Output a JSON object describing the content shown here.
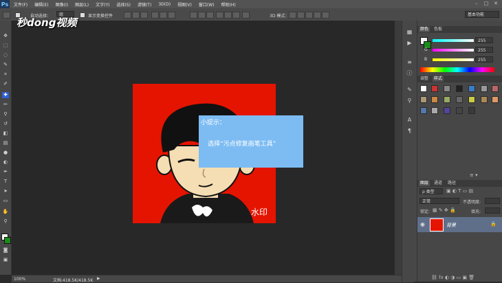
{
  "menubar": {
    "logo": "Ps",
    "items": [
      "文件(F)",
      "编辑(E)",
      "图像(I)",
      "图层(L)",
      "文字(Y)",
      "选择(S)",
      "滤镜(T)",
      "3D(D)",
      "视图(V)",
      "窗口(W)",
      "帮助(H)"
    ]
  },
  "optbar": {
    "auto_select": "自动选择：",
    "auto_select_value": "组",
    "show_transform": "显示变换控件",
    "mode_3d": "3D 模式：",
    "workspace": "基本功能"
  },
  "watermark_logo": "秒dong视频",
  "canvas": {
    "watermark": "水印"
  },
  "tip": {
    "title": "小提示：",
    "body": "选择“污点修复画笔工具”"
  },
  "statusbar": {
    "zoom": "100%",
    "doc": "文档:418.5K/418.5K"
  },
  "color_panel": {
    "tabs": [
      "颜色",
      "色板"
    ],
    "r_label": "R",
    "r_value": "255",
    "g_label": "G",
    "g_value": "255",
    "b_label": "B",
    "b_value": "255"
  },
  "styles_panel": {
    "tabs": [
      "调整",
      "样式"
    ]
  },
  "layers_panel": {
    "tabs": [
      "图层",
      "通道",
      "路径"
    ],
    "kind_filter": "ρ 类型",
    "blend_mode": "正常",
    "opacity_label": "不透明度:",
    "lock_label": "锁定:",
    "fill_label": "填充:",
    "layer_name": "背景"
  },
  "colors": {
    "canvas_red": "#e51400",
    "tip_blue": "#7dbcf3",
    "foreground": "#ffffff",
    "background": "#1a8c1a"
  }
}
